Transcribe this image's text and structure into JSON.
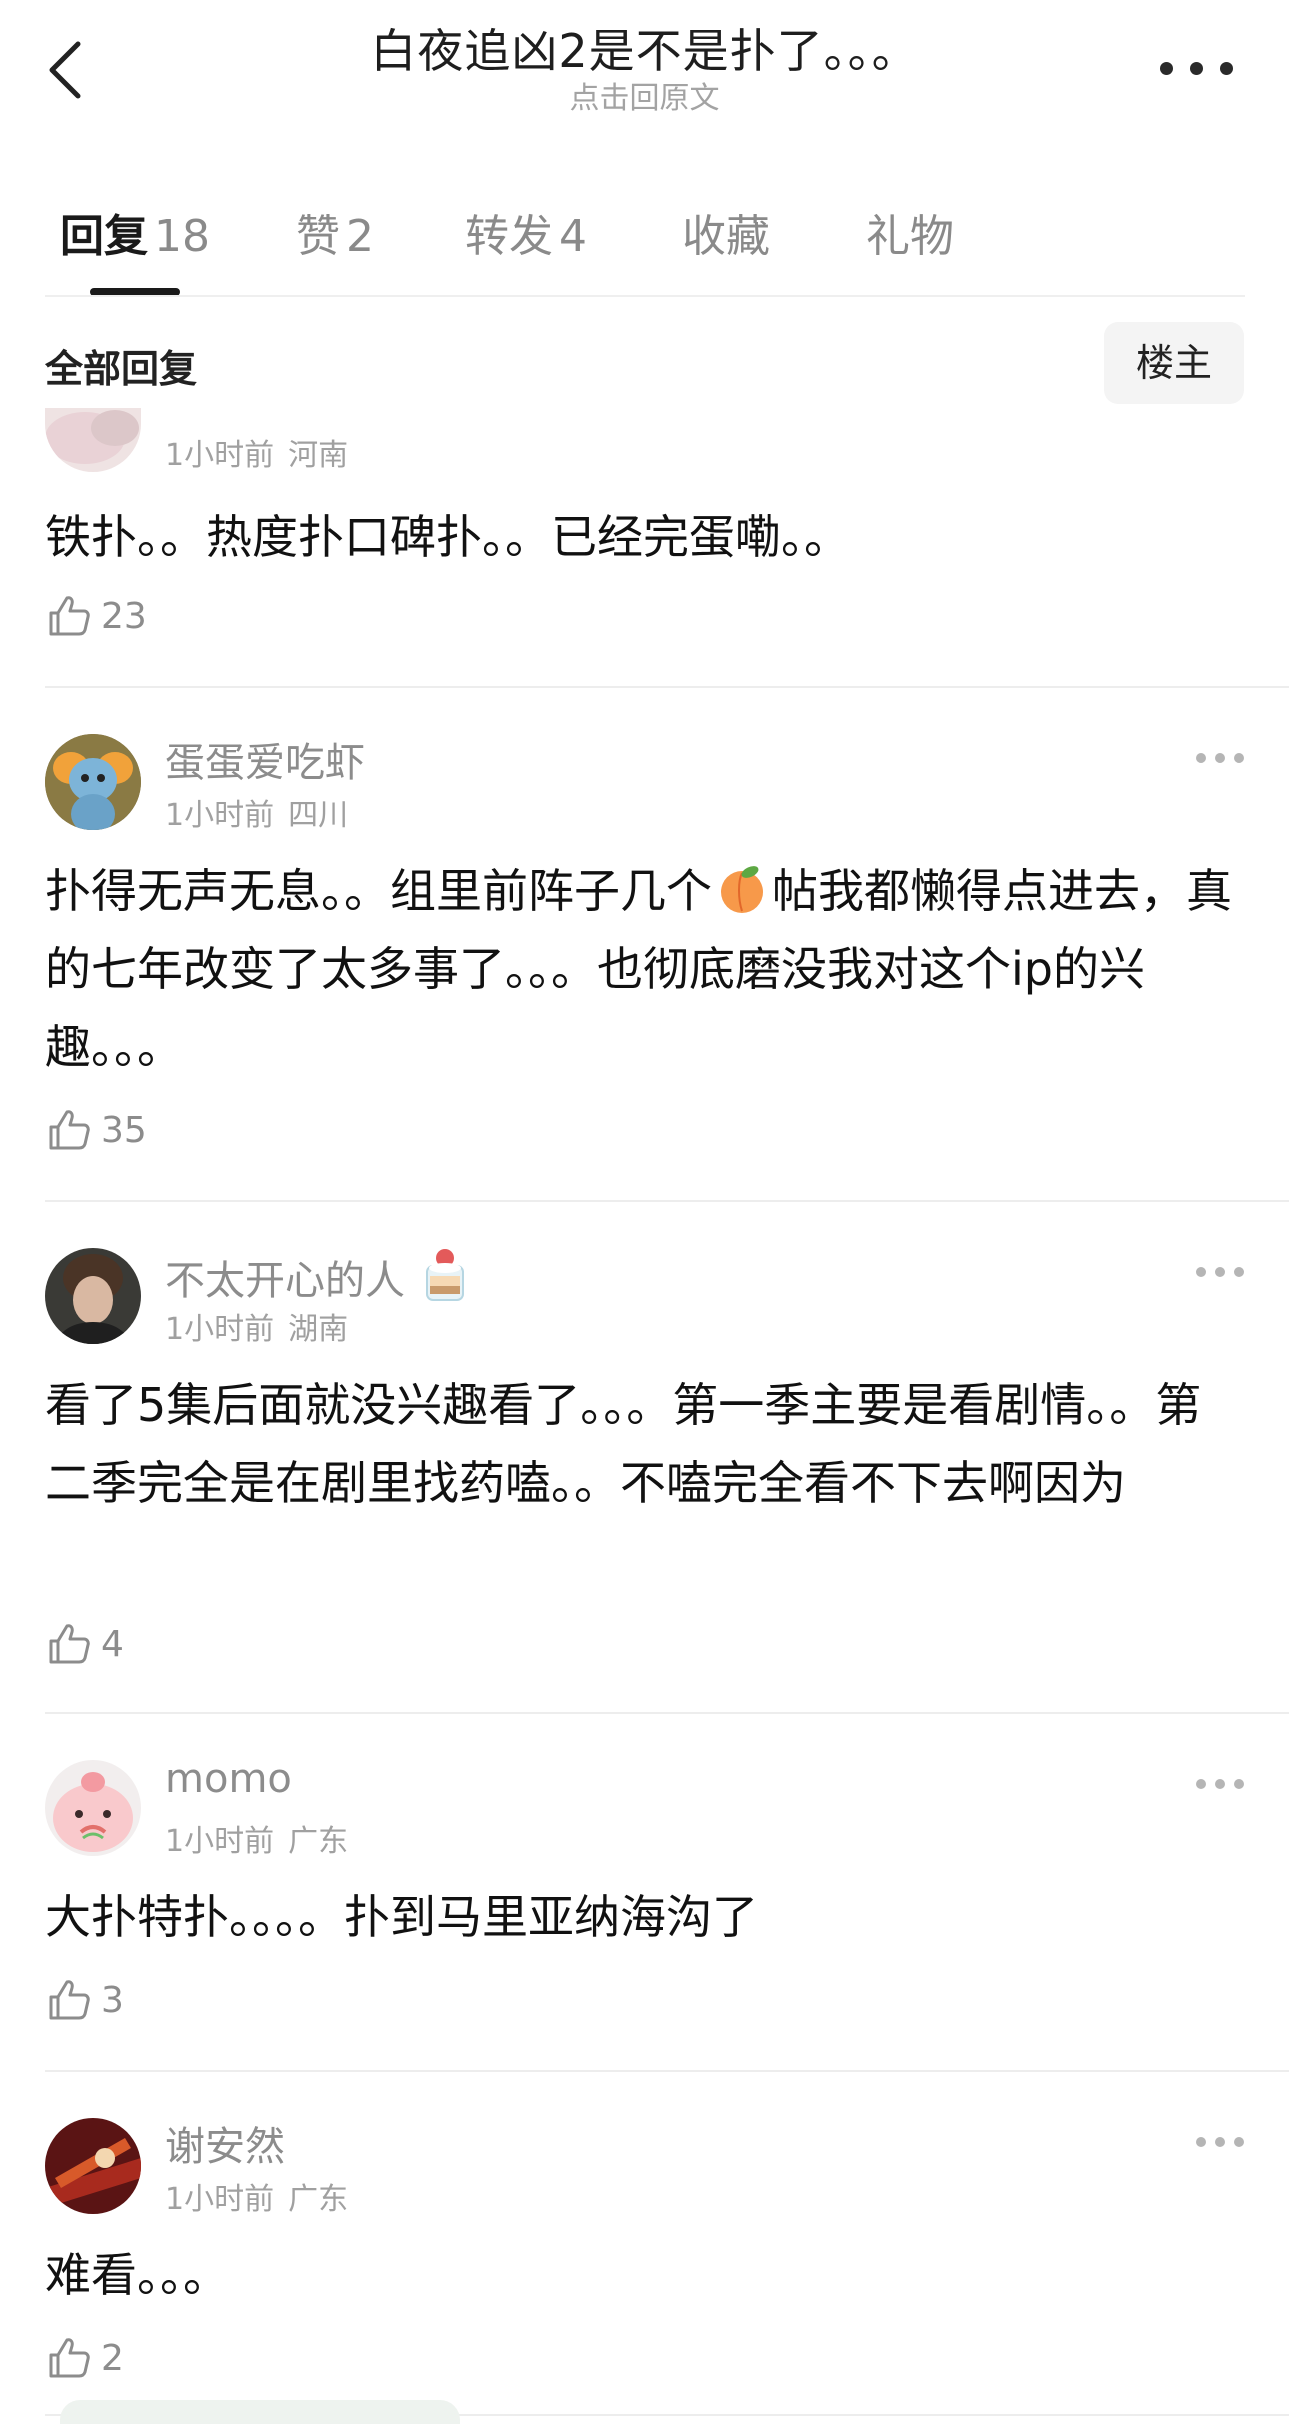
{
  "header": {
    "title": "白夜追凶2是不是扑了。。。",
    "subtitle": "点击回原文"
  },
  "tabs": [
    {
      "label": "回复",
      "count": "18"
    },
    {
      "label": "赞",
      "count": "2"
    },
    {
      "label": "转发",
      "count": "4"
    },
    {
      "label": "收藏",
      "count": ""
    },
    {
      "label": "礼物",
      "count": ""
    }
  ],
  "filter": {
    "all_label": "全部回复",
    "op_label": "楼主"
  },
  "comments": [
    {
      "username": "",
      "time": "1小时前",
      "location": "河南",
      "text": "铁扑。。热度扑口碑扑。。已经完蛋嘞。。",
      "likes": "23"
    },
    {
      "username": "蛋蛋爱吃虾",
      "time": "1小时前",
      "location": "四川",
      "text_before_emoji": "扑得无声无息。。组里前阵子几个",
      "emoji": "peach-emoji",
      "text_after_emoji": "帖我都懒得点进去，真的七年改变了太多事了。。。也彻底磨没我对这个ip的兴趣。。。",
      "likes": "35"
    },
    {
      "username": "不太开心的人",
      "badge": "cake-badge-icon",
      "time": "1小时前",
      "location": "湖南",
      "text": "看了5集后面就没兴趣看了。。。第一季主要是看剧情。。第二季完全是在剧里找药嗑。。不嗑完全看不下去啊因为",
      "likes": "4"
    },
    {
      "username": "momo",
      "time": "1小时前",
      "location": "广东",
      "text": "大扑特扑。。。。扑到马里亚纳海沟了",
      "likes": "3"
    },
    {
      "username": "谢安然",
      "time": "1小时前",
      "location": "广东",
      "text": "难看。。。",
      "likes": "2"
    }
  ],
  "colors": {
    "primary_text": "#1a1a1a",
    "secondary_text": "#8c8c8c",
    "divider": "#ededed",
    "op_button_bg": "#f4f4f4"
  }
}
